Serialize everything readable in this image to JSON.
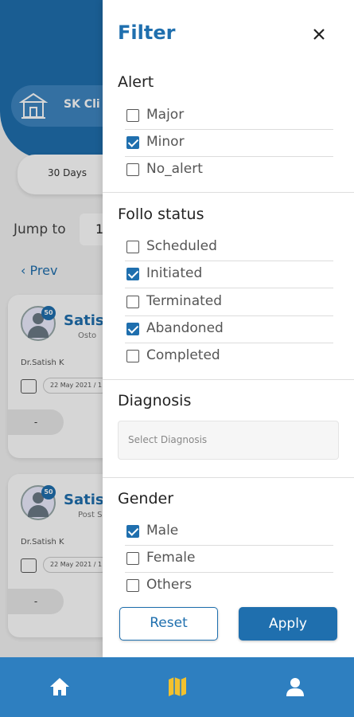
{
  "background": {
    "clinic_name": "SK Cli",
    "days_label": "30 Days",
    "jump_label": "Jump to",
    "jump_value": "1",
    "prev_label": "Prev",
    "cards": [
      {
        "score": "50",
        "name": "Satish",
        "subtitle": "Osto",
        "doctor": "Dr.Satish K",
        "date": "22 May 2021 / 1",
        "button": "-"
      },
      {
        "score": "50",
        "name": "Satish",
        "subtitle": "Post Sai",
        "doctor": "Dr.Satish K",
        "date": "22 May 2021 / 1",
        "button": "-"
      }
    ]
  },
  "filter": {
    "title": "Filter",
    "alert": {
      "title": "Alert",
      "options": [
        {
          "label": "Major",
          "checked": false
        },
        {
          "label": "Minor",
          "checked": true
        },
        {
          "label": "No_alert",
          "checked": false
        }
      ]
    },
    "follo_status": {
      "title": "Follo status",
      "options": [
        {
          "label": "Scheduled",
          "checked": false
        },
        {
          "label": "Initiated",
          "checked": true
        },
        {
          "label": "Terminated",
          "checked": false
        },
        {
          "label": "Abandoned",
          "checked": true
        },
        {
          "label": "Completed",
          "checked": false
        }
      ]
    },
    "diagnosis": {
      "title": "Diagnosis",
      "placeholder": "Select Diagnosis"
    },
    "gender": {
      "title": "Gender",
      "options": [
        {
          "label": "Male",
          "checked": true
        },
        {
          "label": "Female",
          "checked": false
        },
        {
          "label": "Others",
          "checked": false
        }
      ]
    },
    "reset_label": "Reset",
    "apply_label": "Apply"
  },
  "colors": {
    "primary": "#1f6fae",
    "nav_bar": "#2e7fc0",
    "map_icon": "#f2c12e"
  },
  "nav": {
    "items": [
      "home-icon",
      "map-icon",
      "profile-icon"
    ]
  }
}
